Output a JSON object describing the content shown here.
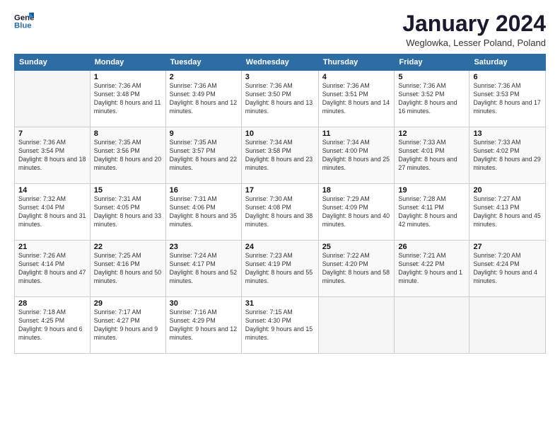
{
  "header": {
    "logo_line1": "General",
    "logo_line2": "Blue",
    "title": "January 2024",
    "location": "Weglowka, Lesser Poland, Poland"
  },
  "weekdays": [
    "Sunday",
    "Monday",
    "Tuesday",
    "Wednesday",
    "Thursday",
    "Friday",
    "Saturday"
  ],
  "weeks": [
    [
      {
        "day": "",
        "empty": true
      },
      {
        "day": "1",
        "sunrise": "7:36 AM",
        "sunset": "3:48 PM",
        "daylight": "8 hours and 11 minutes."
      },
      {
        "day": "2",
        "sunrise": "7:36 AM",
        "sunset": "3:49 PM",
        "daylight": "8 hours and 12 minutes."
      },
      {
        "day": "3",
        "sunrise": "7:36 AM",
        "sunset": "3:50 PM",
        "daylight": "8 hours and 13 minutes."
      },
      {
        "day": "4",
        "sunrise": "7:36 AM",
        "sunset": "3:51 PM",
        "daylight": "8 hours and 14 minutes."
      },
      {
        "day": "5",
        "sunrise": "7:36 AM",
        "sunset": "3:52 PM",
        "daylight": "8 hours and 16 minutes."
      },
      {
        "day": "6",
        "sunrise": "7:36 AM",
        "sunset": "3:53 PM",
        "daylight": "8 hours and 17 minutes."
      }
    ],
    [
      {
        "day": "7",
        "sunrise": "7:36 AM",
        "sunset": "3:54 PM",
        "daylight": "8 hours and 18 minutes."
      },
      {
        "day": "8",
        "sunrise": "7:35 AM",
        "sunset": "3:56 PM",
        "daylight": "8 hours and 20 minutes."
      },
      {
        "day": "9",
        "sunrise": "7:35 AM",
        "sunset": "3:57 PM",
        "daylight": "8 hours and 22 minutes."
      },
      {
        "day": "10",
        "sunrise": "7:34 AM",
        "sunset": "3:58 PM",
        "daylight": "8 hours and 23 minutes."
      },
      {
        "day": "11",
        "sunrise": "7:34 AM",
        "sunset": "4:00 PM",
        "daylight": "8 hours and 25 minutes."
      },
      {
        "day": "12",
        "sunrise": "7:33 AM",
        "sunset": "4:01 PM",
        "daylight": "8 hours and 27 minutes."
      },
      {
        "day": "13",
        "sunrise": "7:33 AM",
        "sunset": "4:02 PM",
        "daylight": "8 hours and 29 minutes."
      }
    ],
    [
      {
        "day": "14",
        "sunrise": "7:32 AM",
        "sunset": "4:04 PM",
        "daylight": "8 hours and 31 minutes."
      },
      {
        "day": "15",
        "sunrise": "7:31 AM",
        "sunset": "4:05 PM",
        "daylight": "8 hours and 33 minutes."
      },
      {
        "day": "16",
        "sunrise": "7:31 AM",
        "sunset": "4:06 PM",
        "daylight": "8 hours and 35 minutes."
      },
      {
        "day": "17",
        "sunrise": "7:30 AM",
        "sunset": "4:08 PM",
        "daylight": "8 hours and 38 minutes."
      },
      {
        "day": "18",
        "sunrise": "7:29 AM",
        "sunset": "4:09 PM",
        "daylight": "8 hours and 40 minutes."
      },
      {
        "day": "19",
        "sunrise": "7:28 AM",
        "sunset": "4:11 PM",
        "daylight": "8 hours and 42 minutes."
      },
      {
        "day": "20",
        "sunrise": "7:27 AM",
        "sunset": "4:13 PM",
        "daylight": "8 hours and 45 minutes."
      }
    ],
    [
      {
        "day": "21",
        "sunrise": "7:26 AM",
        "sunset": "4:14 PM",
        "daylight": "8 hours and 47 minutes."
      },
      {
        "day": "22",
        "sunrise": "7:25 AM",
        "sunset": "4:16 PM",
        "daylight": "8 hours and 50 minutes."
      },
      {
        "day": "23",
        "sunrise": "7:24 AM",
        "sunset": "4:17 PM",
        "daylight": "8 hours and 52 minutes."
      },
      {
        "day": "24",
        "sunrise": "7:23 AM",
        "sunset": "4:19 PM",
        "daylight": "8 hours and 55 minutes."
      },
      {
        "day": "25",
        "sunrise": "7:22 AM",
        "sunset": "4:20 PM",
        "daylight": "8 hours and 58 minutes."
      },
      {
        "day": "26",
        "sunrise": "7:21 AM",
        "sunset": "4:22 PM",
        "daylight": "9 hours and 1 minute."
      },
      {
        "day": "27",
        "sunrise": "7:20 AM",
        "sunset": "4:24 PM",
        "daylight": "9 hours and 4 minutes."
      }
    ],
    [
      {
        "day": "28",
        "sunrise": "7:18 AM",
        "sunset": "4:25 PM",
        "daylight": "9 hours and 6 minutes."
      },
      {
        "day": "29",
        "sunrise": "7:17 AM",
        "sunset": "4:27 PM",
        "daylight": "9 hours and 9 minutes."
      },
      {
        "day": "30",
        "sunrise": "7:16 AM",
        "sunset": "4:29 PM",
        "daylight": "9 hours and 12 minutes."
      },
      {
        "day": "31",
        "sunrise": "7:15 AM",
        "sunset": "4:30 PM",
        "daylight": "9 hours and 15 minutes."
      },
      {
        "day": "",
        "empty": true
      },
      {
        "day": "",
        "empty": true
      },
      {
        "day": "",
        "empty": true
      }
    ]
  ],
  "labels": {
    "sunrise_prefix": "Sunrise: ",
    "sunset_prefix": "Sunset: ",
    "daylight_prefix": "Daylight: "
  }
}
